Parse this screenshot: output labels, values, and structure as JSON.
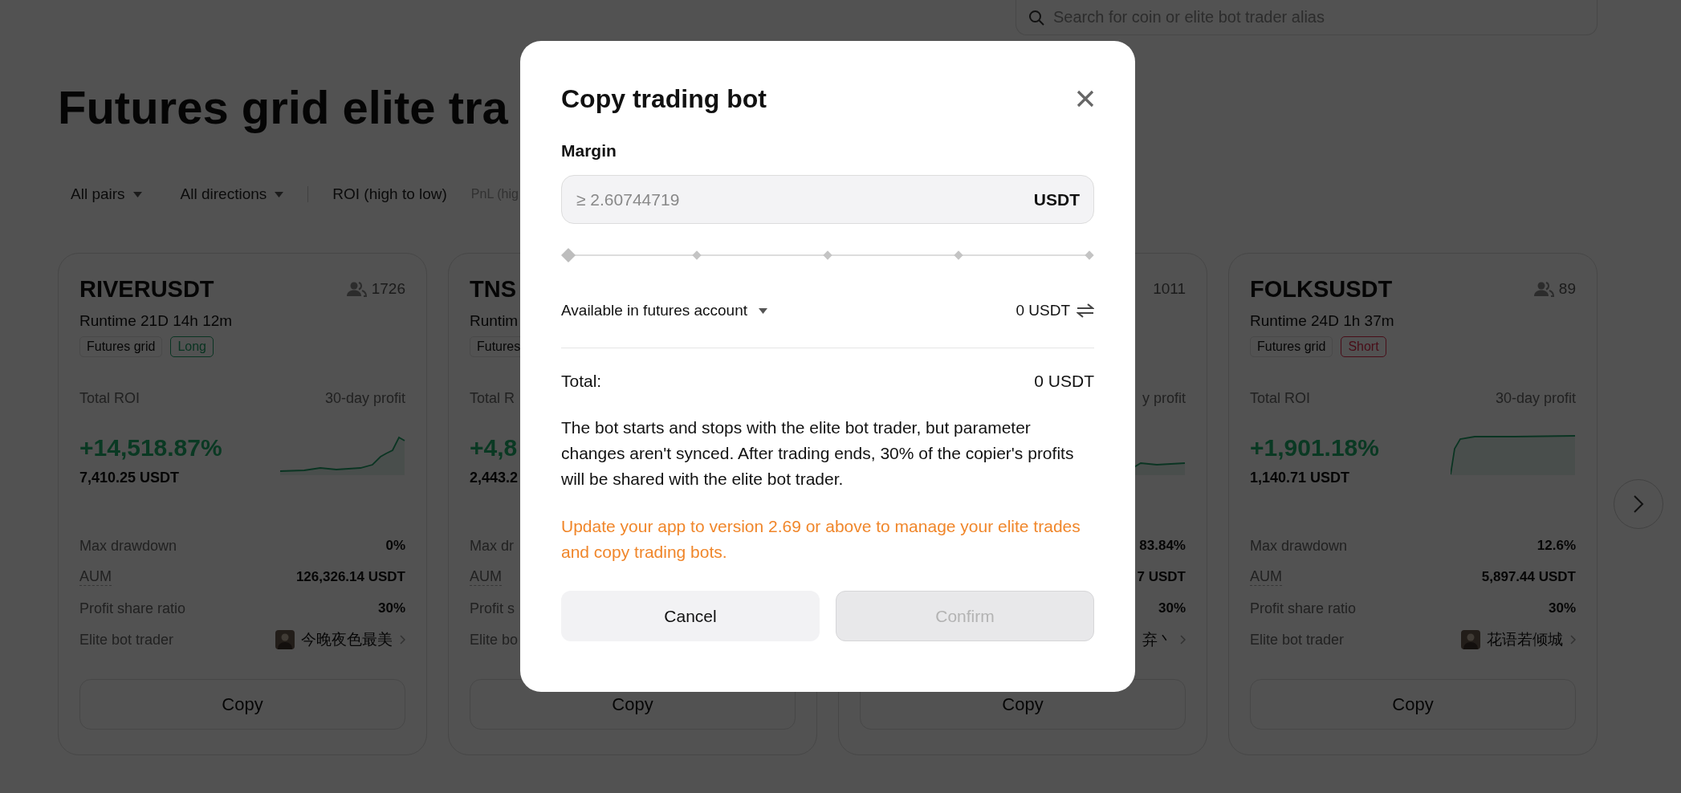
{
  "search": {
    "placeholder": "Search for coin or elite bot trader alias"
  },
  "title": "Futures grid elite tra",
  "dropdowns": [
    {
      "label": "All pairs"
    },
    {
      "label": "All directions"
    }
  ],
  "sort_options": [
    {
      "label": "ROI (high to low)",
      "selected": true
    },
    {
      "label": "PnL (hig",
      "selected": false
    }
  ],
  "cards": [
    {
      "pair": "RIVERUSDT",
      "copiers": "1726",
      "copiers_icon": true,
      "runtime": "Runtime 21D 14h 12m",
      "tags": [
        {
          "label": "Futures grid",
          "kind": "type"
        },
        {
          "label": "Long",
          "kind": "long"
        }
      ],
      "roi_label": "Total ROI",
      "profit_label": "30-day profit",
      "roi": "+14,518.87%",
      "amount": "7,410.25 USDT",
      "sparkline": {
        "kind": "rising"
      },
      "stats": [
        {
          "label": "Max drawdown",
          "value": "0%",
          "kind": "plain"
        },
        {
          "label": "AUM",
          "value": "126,326.14 USDT",
          "kind": "underlined"
        },
        {
          "label": "Profit share ratio",
          "value": "30%",
          "kind": "plain"
        },
        {
          "label": "Elite bot trader",
          "value": "今晚夜色最美",
          "kind": "trader",
          "avatar": true
        }
      ],
      "copy_button": "Copy"
    },
    {
      "pair": "TNS",
      "runtime": "Runtim",
      "tags": [
        {
          "label": "Futures",
          "kind": "type"
        }
      ],
      "roi_label": "Total R",
      "roi": "+4,8",
      "amount": "2,443.2",
      "stats": [
        {
          "label": "Max dr",
          "kind": "plain"
        },
        {
          "label": "AUM",
          "kind": "underlined"
        },
        {
          "label": "Profit s",
          "kind": "plain"
        },
        {
          "label": "Elite bo",
          "kind": "trader"
        }
      ],
      "copy_button": "Copy"
    },
    {
      "copiers": "1011",
      "copiers_icon": false,
      "profit_label": "y profit",
      "sparkline": {
        "kind": "wavy"
      },
      "stats": [
        {
          "value": "83.84%",
          "kind": "plain"
        },
        {
          "value": "7 USDT",
          "kind": "underlined"
        },
        {
          "value": "30%",
          "kind": "plain"
        },
        {
          "value": "弃丶",
          "kind": "trader",
          "avatar": false
        }
      ],
      "copy_button": "Copy"
    },
    {
      "pair": "FOLKSUSDT",
      "copiers": "89",
      "copiers_icon": true,
      "runtime": "Runtime 24D 1h 37m",
      "tags": [
        {
          "label": "Futures grid",
          "kind": "type"
        },
        {
          "label": "Short",
          "kind": "short"
        }
      ],
      "roi_label": "Total ROI",
      "profit_label": "30-day profit",
      "roi": "+1,901.18%",
      "amount": "1,140.71 USDT",
      "sparkline": {
        "kind": "plateau"
      },
      "stats": [
        {
          "label": "Max drawdown",
          "value": "12.6%",
          "kind": "plain"
        },
        {
          "label": "AUM",
          "value": "5,897.44 USDT",
          "kind": "underlined"
        },
        {
          "label": "Profit share ratio",
          "value": "30%",
          "kind": "plain"
        },
        {
          "label": "Elite bot trader",
          "value": "花语若倾城",
          "kind": "trader",
          "avatar": true
        }
      ],
      "copy_button": "Copy"
    }
  ],
  "dialog": {
    "title": "Copy trading bot",
    "margin_label": "Margin",
    "margin_input": {
      "placeholder": "≥ 2.60744719",
      "unit": "USDT"
    },
    "margin_slider": {
      "level": 0
    },
    "account_select": "Available in futures account",
    "available": "0 USDT",
    "total_label": "Total:",
    "total_value": "0 USDT",
    "note": "The bot starts and stops with the elite bot trader, but parameter changes aren't synced. After trading ends, 30% of the copier's profits will be shared with the elite bot trader.",
    "warning": "Update your app to version 2.69 or above to manage your elite trades and copy trading bots.",
    "buttons": [
      {
        "label": "Cancel",
        "disabled": false
      },
      {
        "label": "Confirm",
        "disabled": true
      }
    ]
  }
}
